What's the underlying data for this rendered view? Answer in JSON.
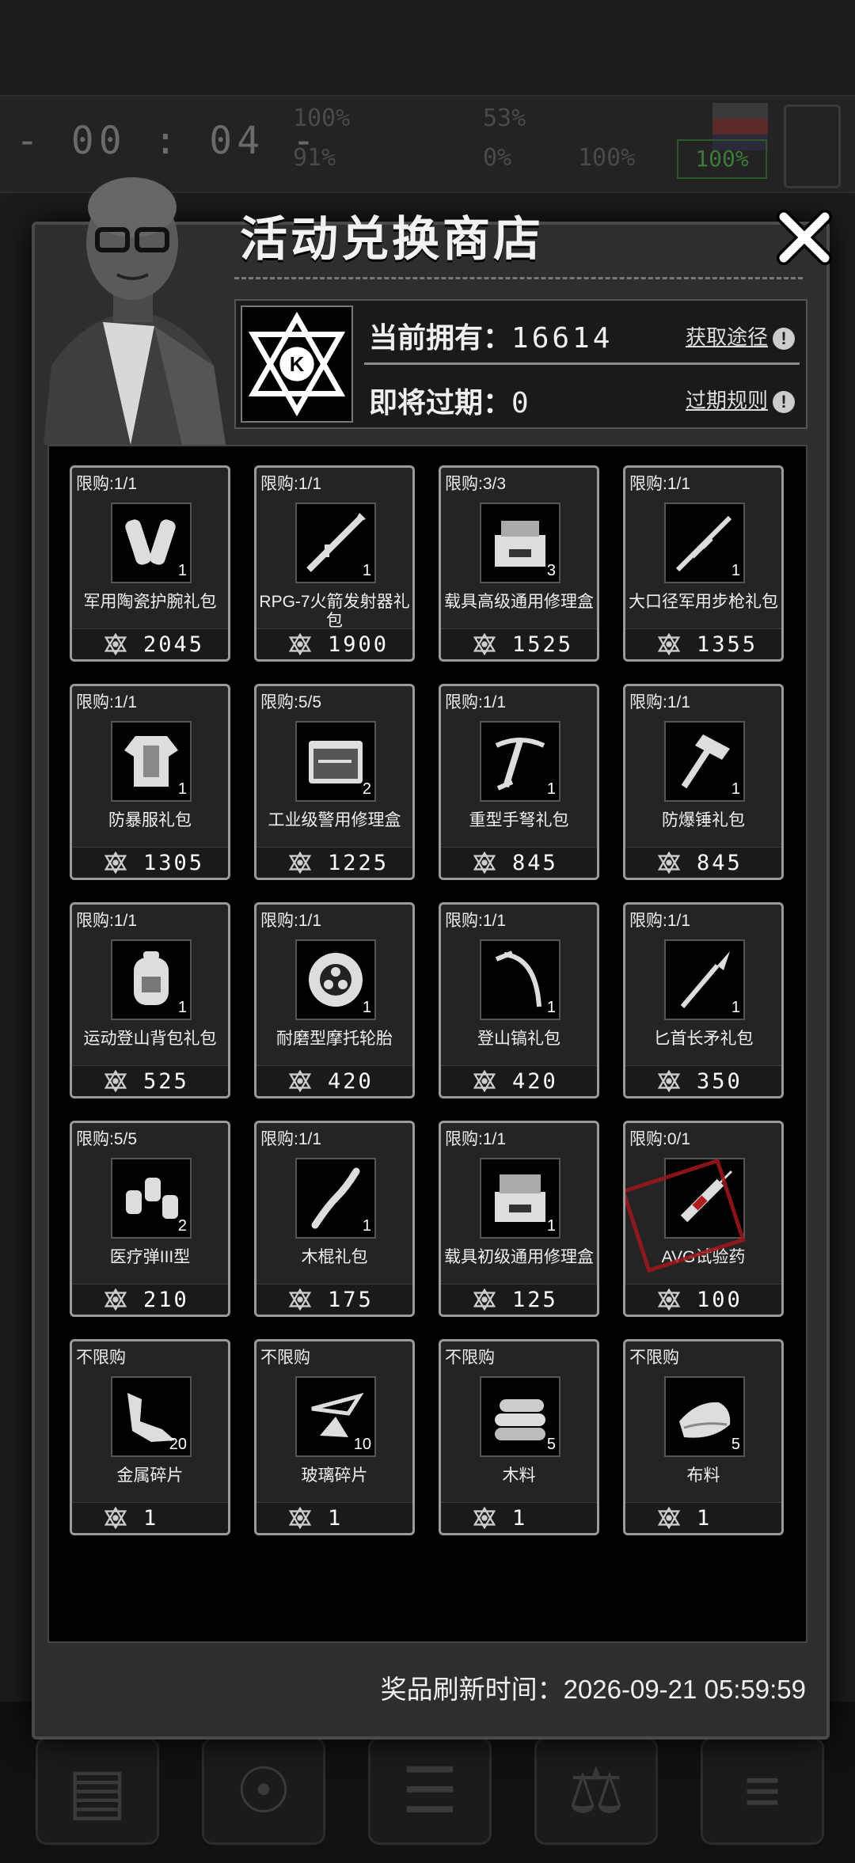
{
  "background": {
    "timer": "- 00 : 04 -",
    "stats": [
      "100%",
      "53%",
      "91%",
      "0%",
      "100%"
    ],
    "green_stat": "100%"
  },
  "modal": {
    "title": "活动兑换商店",
    "owned_label": "当前拥有：",
    "owned_value": "16614",
    "expiring_label": "即将过期：",
    "expiring_value": "0",
    "obtain_link": "获取途径",
    "expire_rule_link": "过期规则",
    "refresh_text": "奖品刷新时间：2026-09-21 05:59:59"
  },
  "items": [
    {
      "limit": "限购:1/1",
      "name": "军用陶瓷护腕礼包",
      "qty": "1",
      "price": "2045",
      "icon": "bracer-icon"
    },
    {
      "limit": "限购:1/1",
      "name": "RPG-7火箭发射器礼包",
      "qty": "1",
      "price": "1900",
      "icon": "rocket-launcher-icon"
    },
    {
      "limit": "限购:3/3",
      "name": "载具高级通用修理盒",
      "qty": "3",
      "price": "1525",
      "icon": "repair-box-icon"
    },
    {
      "limit": "限购:1/1",
      "name": "大口径军用步枪礼包",
      "qty": "1",
      "price": "1355",
      "icon": "rifle-icon"
    },
    {
      "limit": "限购:1/1",
      "name": "防暴服礼包",
      "qty": "1",
      "price": "1305",
      "icon": "armor-icon"
    },
    {
      "limit": "限购:5/5",
      "name": "工业级警用修理盒",
      "qty": "2",
      "price": "1225",
      "icon": "toolkit-icon"
    },
    {
      "limit": "限购:1/1",
      "name": "重型手弩礼包",
      "qty": "1",
      "price": "845",
      "icon": "crossbow-icon"
    },
    {
      "limit": "限购:1/1",
      "name": "防爆锤礼包",
      "qty": "1",
      "price": "845",
      "icon": "hammer-icon"
    },
    {
      "limit": "限购:1/1",
      "name": "运动登山背包礼包",
      "qty": "1",
      "price": "525",
      "icon": "backpack-icon"
    },
    {
      "limit": "限购:1/1",
      "name": "耐磨型摩托轮胎",
      "qty": "1",
      "price": "420",
      "icon": "tire-icon"
    },
    {
      "limit": "限购:1/1",
      "name": "登山镐礼包",
      "qty": "1",
      "price": "420",
      "icon": "ice-axe-icon"
    },
    {
      "limit": "限购:1/1",
      "name": "匕首长矛礼包",
      "qty": "1",
      "price": "350",
      "icon": "spear-icon"
    },
    {
      "limit": "限购:5/5",
      "name": "医疗弹III型",
      "qty": "2",
      "price": "210",
      "icon": "medical-ammo-icon"
    },
    {
      "limit": "限购:1/1",
      "name": "木棍礼包",
      "qty": "1",
      "price": "175",
      "icon": "stick-icon"
    },
    {
      "limit": "限购:1/1",
      "name": "载具初级通用修理盒",
      "qty": "1",
      "price": "125",
      "icon": "basic-repair-box-icon"
    },
    {
      "limit": "限购:0/1",
      "name": "AVG试验药",
      "qty": "",
      "price": "100",
      "icon": "syringe-icon",
      "sold_out": true
    },
    {
      "limit": "不限购",
      "name": "金属碎片",
      "qty": "20",
      "price": "1",
      "icon": "metal-scrap-icon"
    },
    {
      "limit": "不限购",
      "name": "玻璃碎片",
      "qty": "10",
      "price": "1",
      "icon": "glass-shard-icon"
    },
    {
      "limit": "不限购",
      "name": "木料",
      "qty": "5",
      "price": "1",
      "icon": "wood-icon"
    },
    {
      "limit": "不限购",
      "name": "布料",
      "qty": "5",
      "price": "1",
      "icon": "cloth-icon"
    }
  ],
  "colors": {
    "sold_stamp": "#a0181c",
    "card_border": "#9a9a9a"
  }
}
